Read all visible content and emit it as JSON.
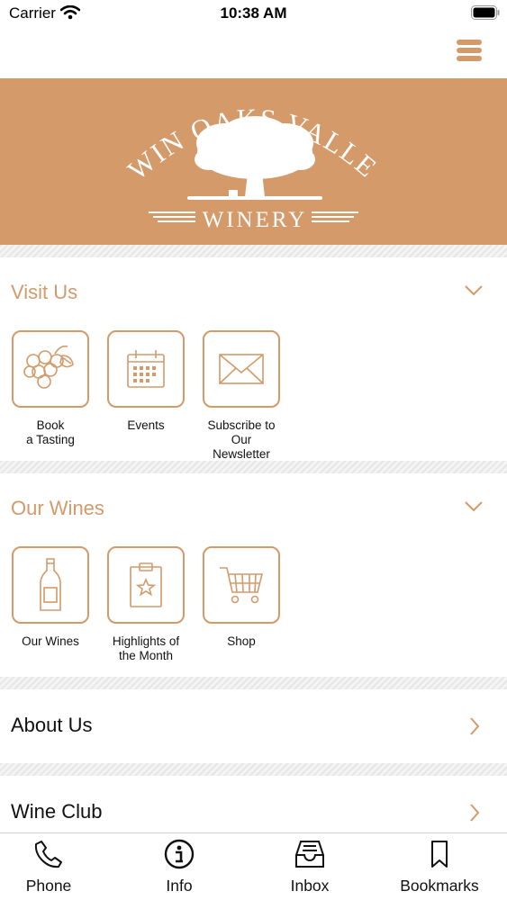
{
  "status": {
    "carrier": "Carrier",
    "time": "10:38 AM"
  },
  "banner": {
    "top_text": "TWIN OAKS VALLEY",
    "bottom_text": "WINERY"
  },
  "accent_color": "#d49a6a",
  "sections": [
    {
      "title": "Visit Us",
      "tiles": [
        {
          "label": "Book\na Tasting",
          "icon": "grapes-icon"
        },
        {
          "label": "Events",
          "icon": "calendar-icon"
        },
        {
          "label": "Subscribe to\nOur\nNewsletter",
          "icon": "envelope-icon"
        }
      ]
    },
    {
      "title": "Our Wines",
      "tiles": [
        {
          "label": "Our Wines",
          "icon": "wine-bottle-icon"
        },
        {
          "label": "Highlights of\nthe Month",
          "icon": "clipboard-star-icon"
        },
        {
          "label": "Shop",
          "icon": "shopping-cart-icon"
        }
      ]
    }
  ],
  "rows": [
    {
      "title": "About Us"
    },
    {
      "title": "Wine Club"
    }
  ],
  "tabs": [
    {
      "label": "Phone",
      "icon": "phone-icon"
    },
    {
      "label": "Info",
      "icon": "info-icon"
    },
    {
      "label": "Inbox",
      "icon": "inbox-icon"
    },
    {
      "label": "Bookmarks",
      "icon": "bookmark-icon"
    }
  ]
}
